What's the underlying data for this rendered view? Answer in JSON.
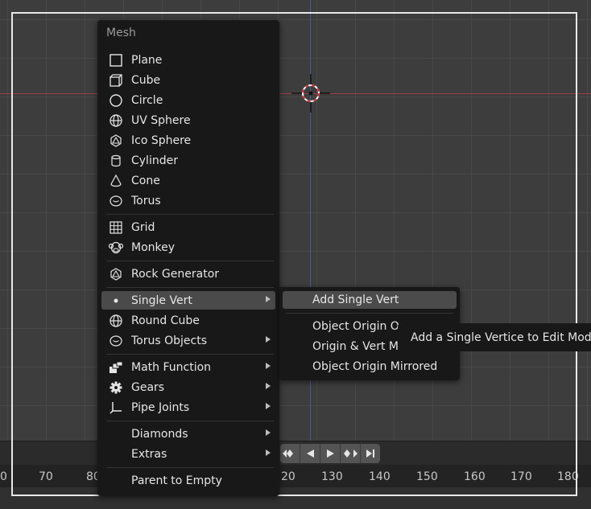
{
  "menu": {
    "title": "Mesh",
    "items": [
      {
        "label": "Plane",
        "icon": "plane-icon"
      },
      {
        "label": "Cube",
        "icon": "cube-icon"
      },
      {
        "label": "Circle",
        "icon": "circle-icon"
      },
      {
        "label": "UV Sphere",
        "icon": "uv-sphere-icon"
      },
      {
        "label": "Ico Sphere",
        "icon": "ico-sphere-icon"
      },
      {
        "label": "Cylinder",
        "icon": "cylinder-icon"
      },
      {
        "label": "Cone",
        "icon": "cone-icon"
      },
      {
        "label": "Torus",
        "icon": "torus-icon"
      },
      {
        "label": "Grid",
        "icon": "grid-icon"
      },
      {
        "label": "Monkey",
        "icon": "monkey-icon"
      },
      {
        "label": "Rock Generator",
        "icon": "ico-sphere-icon"
      },
      {
        "label": "Single Vert",
        "icon": "dot-icon",
        "submenu": true,
        "active": true
      },
      {
        "label": "Round Cube",
        "icon": "uv-sphere-icon"
      },
      {
        "label": "Torus Objects",
        "icon": "torus-icon",
        "submenu": true
      },
      {
        "label": "Math Function",
        "icon": "math-function-icon",
        "submenu": true
      },
      {
        "label": "Gears",
        "icon": "gear-icon",
        "submenu": true
      },
      {
        "label": "Pipe Joints",
        "icon": "pipe-joint-icon",
        "submenu": true
      },
      {
        "label": "Diamonds",
        "icon": "",
        "submenu": true
      },
      {
        "label": "Extras",
        "icon": "",
        "submenu": true
      },
      {
        "label": "Parent to Empty",
        "icon": ""
      }
    ]
  },
  "submenu": {
    "items": [
      {
        "label": "Add Single Vert",
        "active": true
      },
      {
        "label": "Object Origin On"
      },
      {
        "label": "Origin & Vert Mir"
      },
      {
        "label": "Object Origin Mirrored"
      }
    ]
  },
  "tooltip": "Add a Single Vertice to Edit Mode.",
  "timeline": {
    "ticks": [
      "0",
      "70",
      "80",
      "20",
      "130",
      "140",
      "150",
      "160",
      "170",
      "180"
    ]
  },
  "colors": {
    "x_axis": "#9e3b4a",
    "z_axis": "#3f5f96",
    "menu_bg": "#181818",
    "highlight": "#4a4a4a"
  }
}
